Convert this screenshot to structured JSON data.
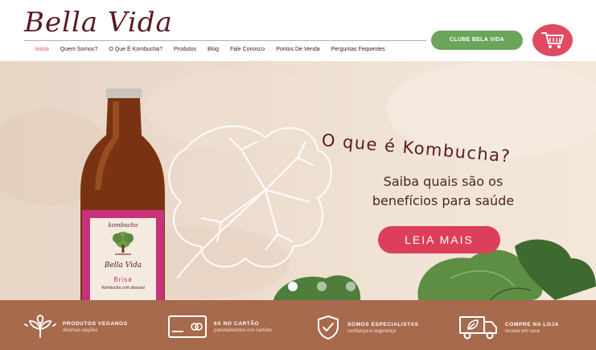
{
  "brand": {
    "logo_text": "Bella Vida"
  },
  "nav": {
    "items": [
      {
        "label": "Início",
        "active": true
      },
      {
        "label": "Quem Somos?"
      },
      {
        "label": "O Que É Kombucha?"
      },
      {
        "label": "Produtos"
      },
      {
        "label": "Blog"
      },
      {
        "label": "Fale Conosco"
      },
      {
        "label": "Pontos De Venda"
      },
      {
        "label": "Perguntas Fequentes"
      }
    ]
  },
  "header": {
    "club_button": "CLUBE BELA VIDA",
    "cart_icon": "shopping-cart-icon"
  },
  "hero": {
    "headline": "O que é Kombucha?",
    "subline": "Saiba quais são os benefícios para saúde",
    "cta": "LEIA MAIS",
    "bottle_brand": "Bella Vida",
    "bottle_top_label": "kombucha",
    "bottle_flavor": "Brisa",
    "bottle_note": "Kombucha com abacaxi",
    "slides_count": 3,
    "active_slide": 1
  },
  "features": [
    {
      "title": "PRODUTOS VEGANOS",
      "subtitle": "diversas opções",
      "icon": "vegan-leaf-icon"
    },
    {
      "title": "6X NO CARTÃO",
      "subtitle": "parcelamentos nos cartões",
      "icon": "credit-card-icon"
    },
    {
      "title": "SOMOS ESPECIALISTAS",
      "subtitle": "confiança e segurança",
      "icon": "shield-check-icon"
    },
    {
      "title": "COMPRE NA LOJA",
      "subtitle": "receba em casa",
      "icon": "delivery-truck-icon"
    }
  ],
  "colors": {
    "brand_dark": "#5a1a24",
    "accent_pink": "#dd3f5b",
    "club_green": "#6aa55a",
    "feature_bar": "#a76a4d"
  }
}
